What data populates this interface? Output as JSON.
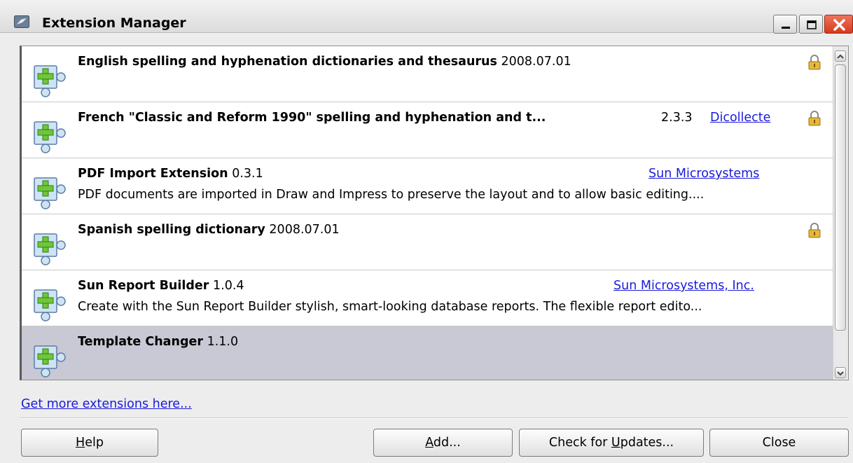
{
  "window": {
    "title": "Extension Manager",
    "controls": [
      "minimize",
      "maximize",
      "close"
    ]
  },
  "extensions": [
    {
      "name": "English spelling and hyphenation dictionaries and thesaurus",
      "version": "2008.07.01",
      "publisher": "",
      "description": "",
      "locked": true,
      "selected": false
    },
    {
      "name": "French \"Classic and Reform 1990\" spelling and hyphenation and t...",
      "version": "2.3.3",
      "publisher": "Dicollecte",
      "description": "",
      "locked": true,
      "selected": false
    },
    {
      "name": "PDF Import Extension",
      "version": "0.3.1",
      "publisher": "Sun Microsystems",
      "description": "PDF documents are imported in Draw and Impress to preserve the layout and to allow basic editing....",
      "locked": false,
      "selected": false
    },
    {
      "name": "Spanish spelling dictionary",
      "version": "2008.07.01",
      "publisher": "",
      "description": "",
      "locked": true,
      "selected": false
    },
    {
      "name": "Sun Report Builder",
      "version": "1.0.4",
      "publisher": "Sun Microsystems, Inc.",
      "description": "Create with the Sun Report Builder stylish, smart-looking database reports. The flexible report edito...",
      "locked": false,
      "selected": false
    },
    {
      "name": "Template Changer",
      "version": "1.1.0",
      "publisher": "",
      "description": "",
      "locked": false,
      "selected": true
    }
  ],
  "more_extensions_link": "Get more extensions here...",
  "buttons": {
    "help": {
      "pre": "",
      "mnemonic": "H",
      "post": "elp"
    },
    "add": {
      "pre": "",
      "mnemonic": "A",
      "post": "dd..."
    },
    "check_updates": {
      "pre": "Check for ",
      "mnemonic": "U",
      "post": "pdates..."
    },
    "close": {
      "pre": "Close",
      "mnemonic": "",
      "post": ""
    }
  },
  "colors": {
    "link": "#1a1adb",
    "selected_row": "#c8c9d5",
    "close_button": "#d63a1c"
  },
  "icons": {
    "app": "extension-manager-icon",
    "extension": "puzzle-piece-add-icon",
    "lock": "padlock-icon"
  }
}
